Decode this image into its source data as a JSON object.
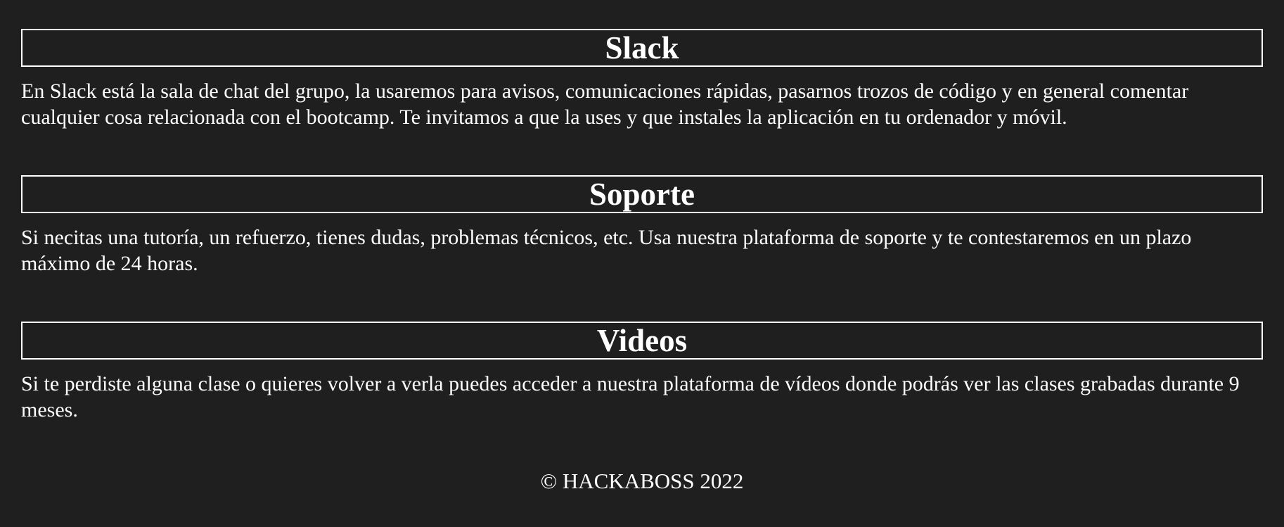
{
  "sections": [
    {
      "title": "Slack",
      "text": "En Slack está la sala de chat del grupo, la usaremos para avisos, comunicaciones rápidas, pasarnos trozos de código y en general comentar cualquier cosa relacionada con el bootcamp. Te invitamos a que la uses y que instales la aplicación en tu ordenador y móvil."
    },
    {
      "title": "Soporte",
      "text": "Si necitas una tutoría, un refuerzo, tienes dudas, problemas técnicos, etc. Usa nuestra plataforma de soporte y te contestaremos en un plazo máximo de 24 horas."
    },
    {
      "title": "Videos",
      "text": "Si te perdiste alguna clase o quieres volver a verla puedes acceder a nuestra plataforma de vídeos donde podrás ver las clases grabadas durante 9 meses."
    }
  ],
  "footer": {
    "copyright": "© HACKABOSS 2022"
  },
  "colors": {
    "background": "#1f1f1f",
    "text": "#ffffff",
    "border": "#ffffff"
  }
}
